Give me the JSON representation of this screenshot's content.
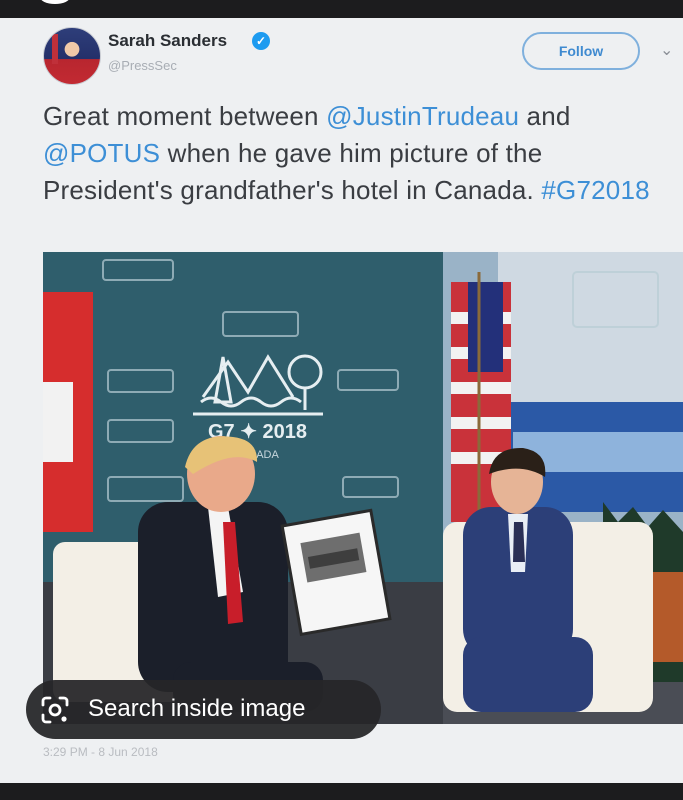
{
  "tweet": {
    "author_name": "Sarah Sanders",
    "verified_mark": "✓",
    "handle": "@PressSec",
    "follow_label": "Follow",
    "more_caret": "⌄",
    "text_part1": "Great moment between ",
    "mention1": "@JustinTrudeau",
    "text_part2": " and ",
    "mention2": "@POTUS",
    "text_part3": " when he gave him picture of the President's grandfather's hotel in Canada. ",
    "hashtag": "#G72018",
    "timestamp": "3:29 PM - 8 Jun 2018"
  },
  "photo": {
    "backdrop_text": "G7 ✦ 2018",
    "backdrop_subtext": "CANADA"
  },
  "lens": {
    "label": "Search inside image",
    "icon": "lens-camera-icon"
  },
  "colors": {
    "link": "#3d8fd6",
    "background": "#eef0f2",
    "backdrop_teal": "#2f5e6c",
    "pill": "#262628"
  }
}
